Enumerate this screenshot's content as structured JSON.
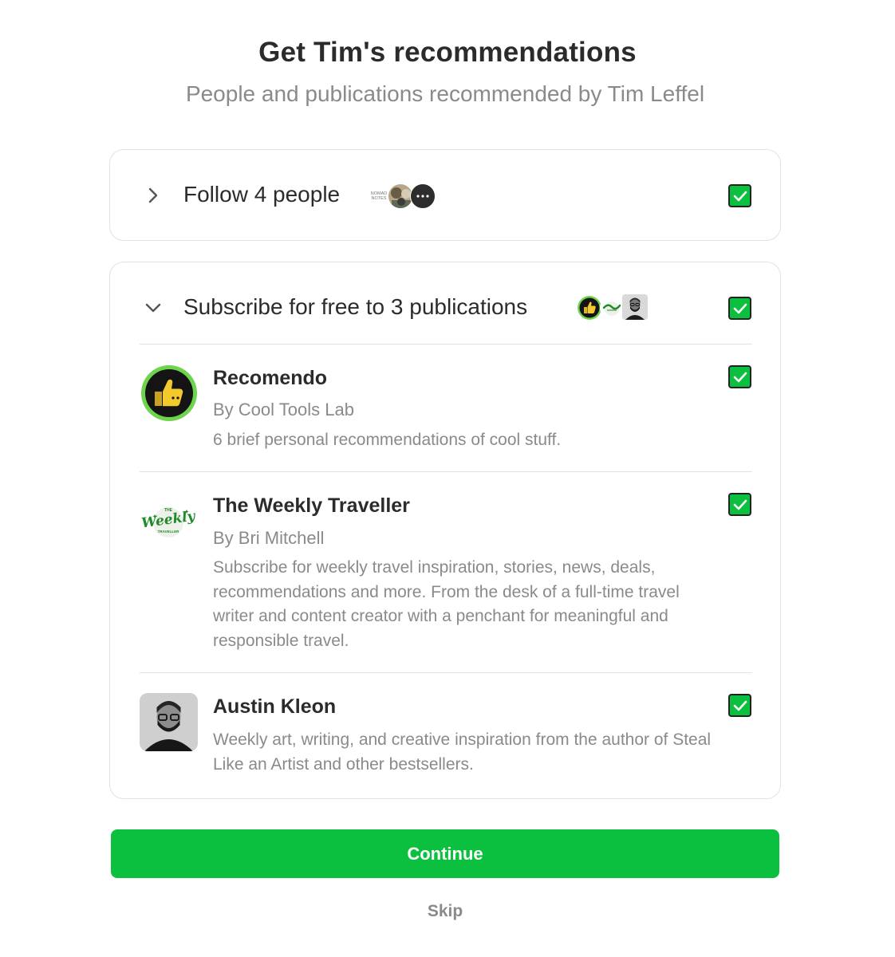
{
  "header": {
    "title": "Get Tim's recommendations",
    "subtitle": "People and publications recommended by Tim Leffel"
  },
  "follow_section": {
    "label": "Follow 4 people",
    "expanded": false,
    "checked": true,
    "avatar_text": "NOMAD NOTES",
    "avatar_icons": [
      "nomad-notes-logo",
      "person-photo",
      "more-dots-icon"
    ]
  },
  "subscribe_section": {
    "label": "Subscribe for free to 3 publications",
    "expanded": true,
    "checked": true,
    "avatar_icons": [
      "thumbs-up-logo",
      "weekly-traveller-logo",
      "person-photo"
    ],
    "publications": [
      {
        "name": "Recomendo",
        "author": "By Cool Tools Lab",
        "description": "6 brief personal recommendations of cool stuff.",
        "logo": "thumbs-up-logo",
        "checked": true
      },
      {
        "name": "The Weekly Traveller",
        "author": "By Bri Mitchell",
        "description": "Subscribe for weekly travel inspiration, stories, news, deals, recommendations and more. From the desk of a full-time travel writer and content creator with a penchant for meaningful and responsible travel.",
        "logo": "weekly-traveller-logo",
        "logo_text_top": "THE",
        "logo_text_main": "Weekly",
        "logo_text_bottom": "TRAVELLER",
        "checked": true
      },
      {
        "name": "Austin Kleon",
        "author": "",
        "description": "Weekly art, writing, and creative inspiration from the author of Steal Like an Artist and other bestsellers.",
        "logo": "person-photo",
        "checked": true
      }
    ]
  },
  "actions": {
    "continue_label": "Continue",
    "skip_label": "Skip"
  },
  "colors": {
    "accent_green": "#0bc03e",
    "title_text": "#2b2b2b",
    "muted_text": "#8a8a8a",
    "border": "#e2e2e2"
  }
}
